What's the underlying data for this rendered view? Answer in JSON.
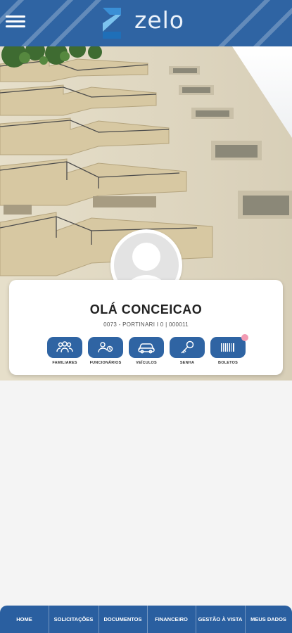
{
  "header": {
    "menu_icon": "hamburger-menu-icon",
    "logo_text": "zelo",
    "brand_color": "#2f64a3"
  },
  "profile": {
    "greeting": "OLÁ CONCEICAO",
    "unit": "0073 - PORTINARI I 0 | 000011"
  },
  "shortcuts": [
    {
      "label": "FAMILIARES",
      "icon": "family-icon"
    },
    {
      "label": "FUNCIONÁRIOS",
      "icon": "employees-icon"
    },
    {
      "label": "VEÍCULOS",
      "icon": "car-icon"
    },
    {
      "label": "SENHA",
      "icon": "key-icon"
    },
    {
      "label": "BOLETOS",
      "icon": "barcode-icon",
      "badge": true
    }
  ],
  "bottom_nav": [
    {
      "label": "HOME"
    },
    {
      "label": "SOLICITAÇÕES"
    },
    {
      "label": "DOCUMENTOS"
    },
    {
      "label": "FINANCEIRO"
    },
    {
      "label": "GESTÃO À VISTA"
    },
    {
      "label": "MEUS DADOS"
    }
  ]
}
